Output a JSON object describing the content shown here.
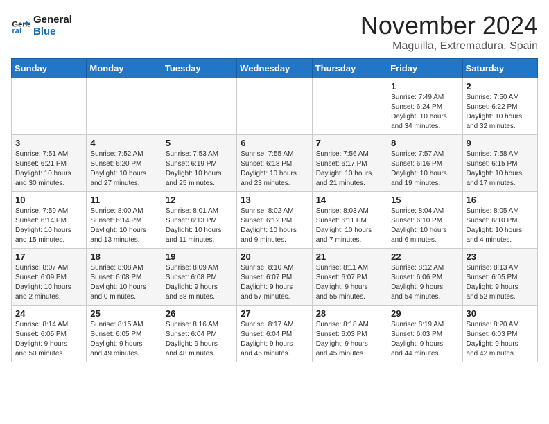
{
  "logo": {
    "line1": "General",
    "line2": "Blue"
  },
  "title": "November 2024",
  "location": "Maguilla, Extremadura, Spain",
  "weekdays": [
    "Sunday",
    "Monday",
    "Tuesday",
    "Wednesday",
    "Thursday",
    "Friday",
    "Saturday"
  ],
  "weeks": [
    [
      {
        "day": "",
        "info": ""
      },
      {
        "day": "",
        "info": ""
      },
      {
        "day": "",
        "info": ""
      },
      {
        "day": "",
        "info": ""
      },
      {
        "day": "",
        "info": ""
      },
      {
        "day": "1",
        "info": "Sunrise: 7:49 AM\nSunset: 6:24 PM\nDaylight: 10 hours\nand 34 minutes."
      },
      {
        "day": "2",
        "info": "Sunrise: 7:50 AM\nSunset: 6:22 PM\nDaylight: 10 hours\nand 32 minutes."
      }
    ],
    [
      {
        "day": "3",
        "info": "Sunrise: 7:51 AM\nSunset: 6:21 PM\nDaylight: 10 hours\nand 30 minutes."
      },
      {
        "day": "4",
        "info": "Sunrise: 7:52 AM\nSunset: 6:20 PM\nDaylight: 10 hours\nand 27 minutes."
      },
      {
        "day": "5",
        "info": "Sunrise: 7:53 AM\nSunset: 6:19 PM\nDaylight: 10 hours\nand 25 minutes."
      },
      {
        "day": "6",
        "info": "Sunrise: 7:55 AM\nSunset: 6:18 PM\nDaylight: 10 hours\nand 23 minutes."
      },
      {
        "day": "7",
        "info": "Sunrise: 7:56 AM\nSunset: 6:17 PM\nDaylight: 10 hours\nand 21 minutes."
      },
      {
        "day": "8",
        "info": "Sunrise: 7:57 AM\nSunset: 6:16 PM\nDaylight: 10 hours\nand 19 minutes."
      },
      {
        "day": "9",
        "info": "Sunrise: 7:58 AM\nSunset: 6:15 PM\nDaylight: 10 hours\nand 17 minutes."
      }
    ],
    [
      {
        "day": "10",
        "info": "Sunrise: 7:59 AM\nSunset: 6:14 PM\nDaylight: 10 hours\nand 15 minutes."
      },
      {
        "day": "11",
        "info": "Sunrise: 8:00 AM\nSunset: 6:14 PM\nDaylight: 10 hours\nand 13 minutes."
      },
      {
        "day": "12",
        "info": "Sunrise: 8:01 AM\nSunset: 6:13 PM\nDaylight: 10 hours\nand 11 minutes."
      },
      {
        "day": "13",
        "info": "Sunrise: 8:02 AM\nSunset: 6:12 PM\nDaylight: 10 hours\nand 9 minutes."
      },
      {
        "day": "14",
        "info": "Sunrise: 8:03 AM\nSunset: 6:11 PM\nDaylight: 10 hours\nand 7 minutes."
      },
      {
        "day": "15",
        "info": "Sunrise: 8:04 AM\nSunset: 6:10 PM\nDaylight: 10 hours\nand 6 minutes."
      },
      {
        "day": "16",
        "info": "Sunrise: 8:05 AM\nSunset: 6:10 PM\nDaylight: 10 hours\nand 4 minutes."
      }
    ],
    [
      {
        "day": "17",
        "info": "Sunrise: 8:07 AM\nSunset: 6:09 PM\nDaylight: 10 hours\nand 2 minutes."
      },
      {
        "day": "18",
        "info": "Sunrise: 8:08 AM\nSunset: 6:08 PM\nDaylight: 10 hours\nand 0 minutes."
      },
      {
        "day": "19",
        "info": "Sunrise: 8:09 AM\nSunset: 6:08 PM\nDaylight: 9 hours\nand 58 minutes."
      },
      {
        "day": "20",
        "info": "Sunrise: 8:10 AM\nSunset: 6:07 PM\nDaylight: 9 hours\nand 57 minutes."
      },
      {
        "day": "21",
        "info": "Sunrise: 8:11 AM\nSunset: 6:07 PM\nDaylight: 9 hours\nand 55 minutes."
      },
      {
        "day": "22",
        "info": "Sunrise: 8:12 AM\nSunset: 6:06 PM\nDaylight: 9 hours\nand 54 minutes."
      },
      {
        "day": "23",
        "info": "Sunrise: 8:13 AM\nSunset: 6:05 PM\nDaylight: 9 hours\nand 52 minutes."
      }
    ],
    [
      {
        "day": "24",
        "info": "Sunrise: 8:14 AM\nSunset: 6:05 PM\nDaylight: 9 hours\nand 50 minutes."
      },
      {
        "day": "25",
        "info": "Sunrise: 8:15 AM\nSunset: 6:05 PM\nDaylight: 9 hours\nand 49 minutes."
      },
      {
        "day": "26",
        "info": "Sunrise: 8:16 AM\nSunset: 6:04 PM\nDaylight: 9 hours\nand 48 minutes."
      },
      {
        "day": "27",
        "info": "Sunrise: 8:17 AM\nSunset: 6:04 PM\nDaylight: 9 hours\nand 46 minutes."
      },
      {
        "day": "28",
        "info": "Sunrise: 8:18 AM\nSunset: 6:03 PM\nDaylight: 9 hours\nand 45 minutes."
      },
      {
        "day": "29",
        "info": "Sunrise: 8:19 AM\nSunset: 6:03 PM\nDaylight: 9 hours\nand 44 minutes."
      },
      {
        "day": "30",
        "info": "Sunrise: 8:20 AM\nSunset: 6:03 PM\nDaylight: 9 hours\nand 42 minutes."
      }
    ]
  ]
}
